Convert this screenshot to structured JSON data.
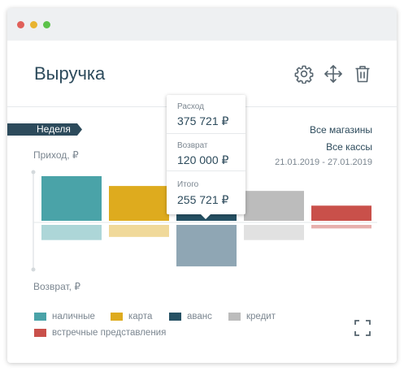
{
  "window": {
    "controls": [
      "close",
      "minimize",
      "maximize"
    ]
  },
  "widget": {
    "title": "Выручка",
    "tools": [
      {
        "name": "settings-icon",
        "icon": "gear"
      },
      {
        "name": "move-icon",
        "icon": "arrows-move"
      },
      {
        "name": "delete-icon",
        "icon": "trash"
      }
    ]
  },
  "period_tab": "Неделя",
  "filters": {
    "store": "Все магазины",
    "register": "Все кассы",
    "date_range": "21.01.2019 - 27.01.2019"
  },
  "colors": {
    "nalichnye": "#4aa3a8",
    "karta": "#deab1e",
    "avans": "#265164",
    "kredit": "#bcbcbc",
    "vstrechnye": "#c9504a",
    "title": "#2d4b5c"
  },
  "chart_data": {
    "type": "bar",
    "ylabel_top": "Приход, ₽",
    "ylabel_bottom": "Возврат, ₽",
    "categories": [
      "наличные",
      "карта",
      "аванс",
      "кредит",
      "встречные представления"
    ],
    "series": [
      {
        "name": "Приход",
        "values": [
          100,
          78,
          22,
          67,
          34
        ]
      },
      {
        "name": "Возврат",
        "values": [
          34,
          27,
          93,
          34,
          8
        ]
      }
    ],
    "highlighted_index": 2
  },
  "tooltip": {
    "rows": [
      {
        "label": "Расход",
        "value": "375 721 ₽"
      },
      {
        "label": "Возврат",
        "value": "120 000 ₽"
      },
      {
        "label": "Итого",
        "value": "255 721 ₽"
      }
    ]
  },
  "legend": [
    {
      "label": "наличные",
      "color": "#4aa3a8"
    },
    {
      "label": "карта",
      "color": "#deab1e"
    },
    {
      "label": "аванс",
      "color": "#265164"
    },
    {
      "label": "кредит",
      "color": "#bcbcbc"
    },
    {
      "label": "встречные представления",
      "color": "#c9504a"
    }
  ]
}
